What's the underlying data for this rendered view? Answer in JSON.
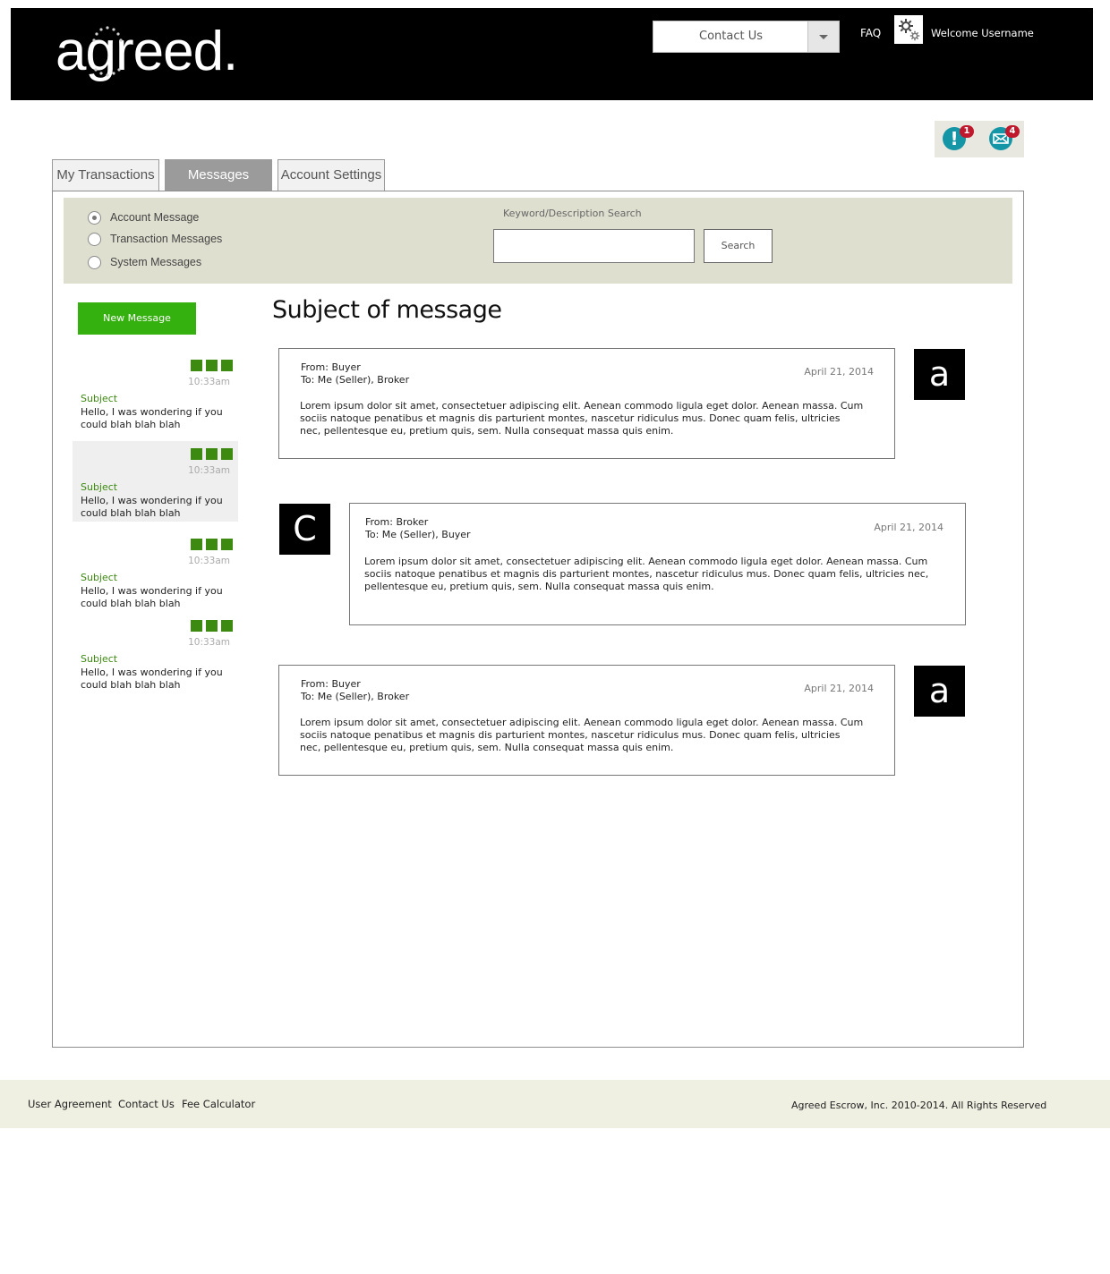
{
  "header": {
    "logo_text": "agreed.",
    "contact_select_value": "Contact Us",
    "faq_label": "FAQ",
    "welcome_text": "Welcome Username"
  },
  "notifications": {
    "alerts_icon": "exclamation-icon",
    "alerts_count": "1",
    "mail_icon": "envelope-icon",
    "mail_count": "4"
  },
  "tabs": [
    {
      "label": "My Transactions",
      "active": false
    },
    {
      "label": "Messages",
      "active": true
    },
    {
      "label": "Account Settings",
      "active": false
    }
  ],
  "filters": {
    "options": [
      {
        "label": "Account Message",
        "checked": true
      },
      {
        "label": "Transaction Messages",
        "checked": false
      },
      {
        "label": "System Messages",
        "checked": false
      }
    ],
    "search_label": "Keyword/Description Search",
    "search_value": "",
    "search_button": "Search"
  },
  "message_list": {
    "new_message_label": "New Message",
    "items": [
      {
        "time": "10:33am",
        "subject": "Subject",
        "preview": "Hello, I was wondering if you could blah blah blah",
        "selected": false
      },
      {
        "time": "10:33am",
        "subject": "Subject",
        "preview": "Hello, I was wondering if you could blah blah blah",
        "selected": true
      },
      {
        "time": "10:33am",
        "subject": "Subject",
        "preview": "Hello, I was wondering if you could blah blah blah",
        "selected": false
      },
      {
        "time": "10:33am",
        "subject": "Subject",
        "preview": "Hello, I was wondering if you could blah blah blah",
        "selected": false
      }
    ]
  },
  "thread": {
    "title": "Subject of message",
    "messages": [
      {
        "from": "From: Buyer",
        "to": "To: Me (Seller), Broker",
        "date": "April 21, 2014",
        "avatar": "a",
        "body": "Lorem ipsum dolor sit amet, consectetuer adipiscing elit. Aenean commodo ligula eget dolor. Aenean massa. Cum sociis natoque penatibus et magnis dis parturient montes, nascetur ridiculus mus. Donec quam felis, ultricies nec, pellentesque eu, pretium quis, sem. Nulla consequat massa quis enim."
      },
      {
        "from": "From: Broker",
        "to": "To: Me (Seller), Buyer",
        "date": "April 21, 2014",
        "avatar": "C",
        "body": "Lorem ipsum dolor sit amet, consectetuer adipiscing elit. Aenean commodo ligula eget dolor. Aenean massa. Cum sociis natoque penatibus et magnis dis parturient montes, nascetur ridiculus mus. Donec quam felis, ultricies nec, pellentesque eu, pretium quis, sem. Nulla consequat massa quis enim."
      },
      {
        "from": "From: Buyer",
        "to": "To: Me (Seller), Broker",
        "date": "April 21, 2014",
        "avatar": "a",
        "body": "Lorem ipsum dolor sit amet, consectetuer adipiscing elit. Aenean commodo ligula eget dolor. Aenean massa. Cum sociis natoque penatibus et magnis dis parturient montes, nascetur ridiculus mus. Donec quam felis, ultricies nec, pellentesque eu, pretium quis, sem. Nulla consequat massa quis enim."
      }
    ]
  },
  "footer": {
    "links": [
      "User Agreement",
      "Contact Us",
      "Fee Calculator"
    ],
    "copyright": "Agreed Escrow, Inc. 2010-2014.  All Rights Reserved"
  },
  "colors": {
    "brand_green": "#34b00f",
    "subject_green": "#3d8a10",
    "filter_bg": "#dfdfd0",
    "badge_red": "#c0182c",
    "icon_teal": "#1596a6"
  }
}
